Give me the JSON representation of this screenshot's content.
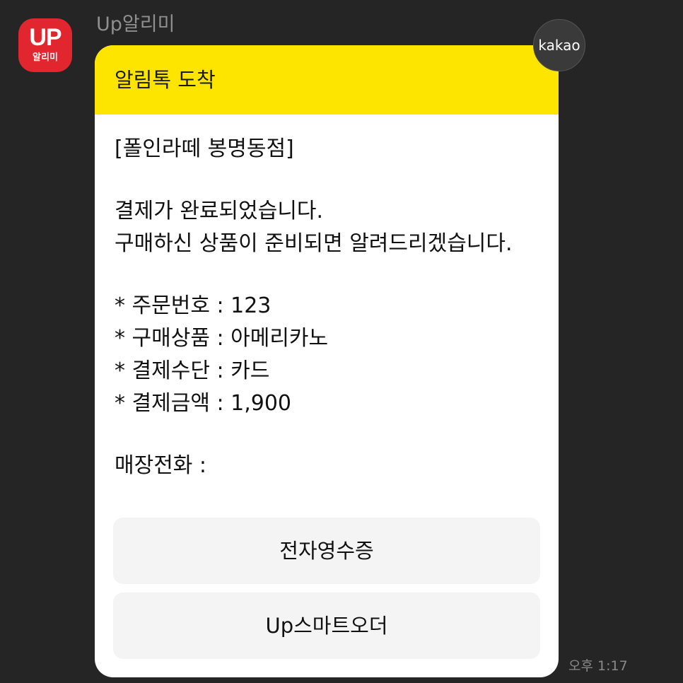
{
  "sender": {
    "name": "Up알리미",
    "avatar_logo": "UP",
    "avatar_sub": "알리미"
  },
  "badge": "kakao",
  "message": {
    "header": "알림톡 도착",
    "store": "[폴인라떼 봉명동점]",
    "notice_line1": "결제가 완료되었습니다.",
    "notice_line2": "구매하신 상품이 준비되면 알려드리겠습니다.",
    "details": [
      "* 주문번호 : 123",
      "* 구매상품 : 아메리카노",
      "* 결제수단 : 카드",
      "* 결제금액 : 1,900"
    ],
    "store_phone": "매장전화 :",
    "buttons": {
      "receipt": "전자영수증",
      "order": "Up스마트오더"
    }
  },
  "timestamp": "오후 1:17",
  "colors": {
    "background": "#252525",
    "header_yellow": "#fee500",
    "avatar_red": "#e2262f"
  }
}
